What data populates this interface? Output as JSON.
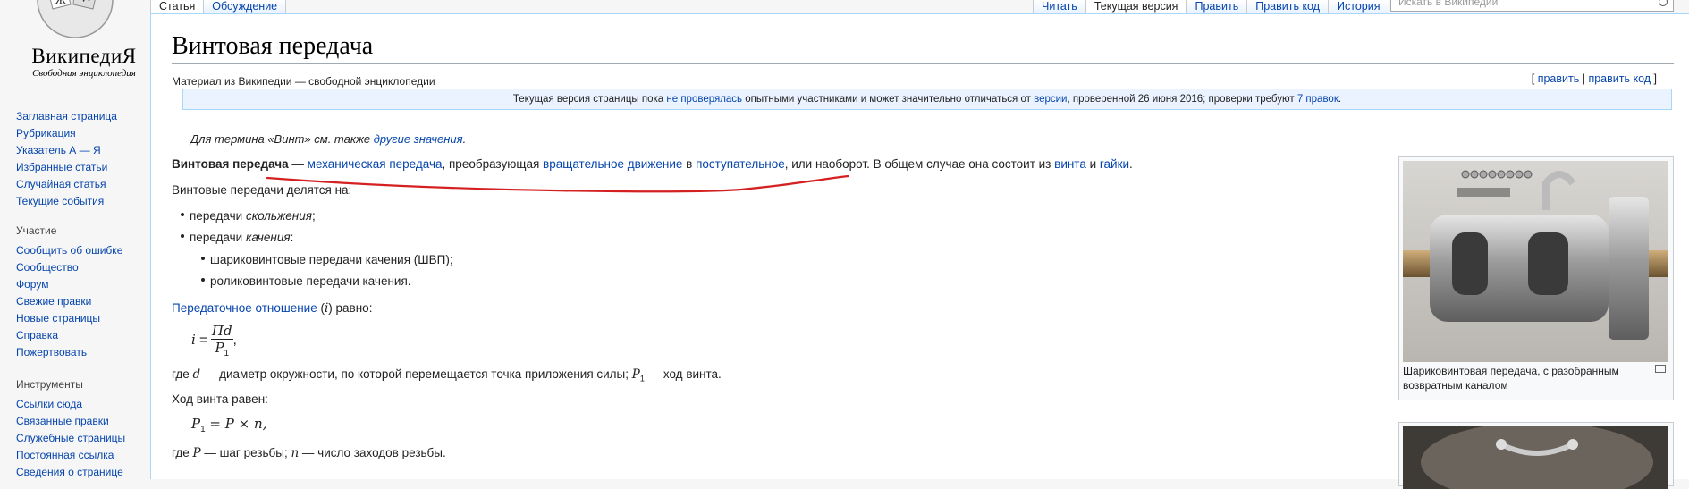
{
  "sidebar": {
    "wordmark": "ВикипедиЯ",
    "tagline": "Свободная энциклопедия",
    "main_items": [
      "Заглавная страница",
      "Рубрикация",
      "Указатель А — Я",
      "Избранные статьи",
      "Случайная статья",
      "Текущие события"
    ],
    "participation_title": "Участие",
    "participation_items": [
      "Сообщить об ошибке",
      "Сообщество",
      "Форум",
      "Свежие правки",
      "Новые страницы",
      "Справка",
      "Пожертвовать"
    ],
    "tools_title": "Инструменты",
    "tools_items": [
      "Ссылки сюда",
      "Связанные правки",
      "Служебные страницы",
      "Постоянная ссылка",
      "Сведения о странице"
    ]
  },
  "tabs": {
    "left": [
      "Статья",
      "Обсуждение"
    ],
    "right": [
      "Читать",
      "Текущая версия",
      "Править",
      "Править код",
      "История"
    ],
    "selected_left": "Статья",
    "selected_right": "Текущая версия"
  },
  "search": {
    "placeholder": "Искать в Википедии"
  },
  "page": {
    "title": "Винтовая передача",
    "site_sub": "Материал из Википедии — свободной энциклопедии",
    "edit_links": {
      "open": "[ ",
      "edit": "править",
      "sep": " | ",
      "edit_code": "править код",
      "close": " ]"
    },
    "notice": {
      "t1": "Текущая версия страницы пока ",
      "l1": "не проверялась",
      "t2": " опытными участниками и может значительно отличаться от ",
      "l2": "версии",
      "t3": ", проверенной 26 июня 2016; проверки требуют ",
      "l3": "7 правок",
      "t4": "."
    },
    "hatnote": {
      "text": "Для термина «Винт» см. также ",
      "link": "другие значения",
      "end": "."
    },
    "lead": {
      "bold": "Винтовая передача",
      "t1": " — ",
      "l1": "механическая передача",
      "t2": ", преобразующая ",
      "l2": "вращательное движение",
      "t3": " в ",
      "l3": "поступательное",
      "t4": ", или наоборот. В общем случае она состоит из ",
      "l4": "винта",
      "t5": " и ",
      "l5": "гайки",
      "t6": "."
    },
    "divided": "Винтовые передачи делятся на:",
    "list": {
      "item1_a": "передачи ",
      "item1_b": "скольжения",
      "item1_c": ";",
      "item2_a": "передачи ",
      "item2_b": "качения",
      "item2_c": ":",
      "sub1": "шариковинтовые передачи качения (ШВП);",
      "sub2": "роликовинтовые передачи качения."
    },
    "ratio": {
      "link": "Передаточное отношение",
      "t1": " (",
      "var": "i",
      "t2": ") равно:"
    },
    "formula1": {
      "lhs": "i",
      "eq": " = ",
      "num": "Πd",
      "den": "P",
      "den_sub": "1",
      "end": ","
    },
    "where1": {
      "t1": "где ",
      "v1": "d",
      "t2": " — диаметр окружности, по которой перемещается точка приложения силы; ",
      "v2": "P",
      "v2sub": "1",
      "t3": " — ход винта."
    },
    "stroke": "Ход винта равен:",
    "formula2": {
      "lhs": "P",
      "lhs_sub": "1",
      "rest": " = P × n,"
    },
    "where2": {
      "t1": "где ",
      "v1": "P",
      "t2": " — шаг резьбы; ",
      "v2": "n",
      "t3": " — число заходов резьбы."
    },
    "thumb_caption": "Шариковинтовая передача, с разобранным возвратным каналом"
  },
  "colors": {
    "link": "#0645ad",
    "annotation": "#d42020",
    "notice_bg": "#eaf3ff"
  }
}
